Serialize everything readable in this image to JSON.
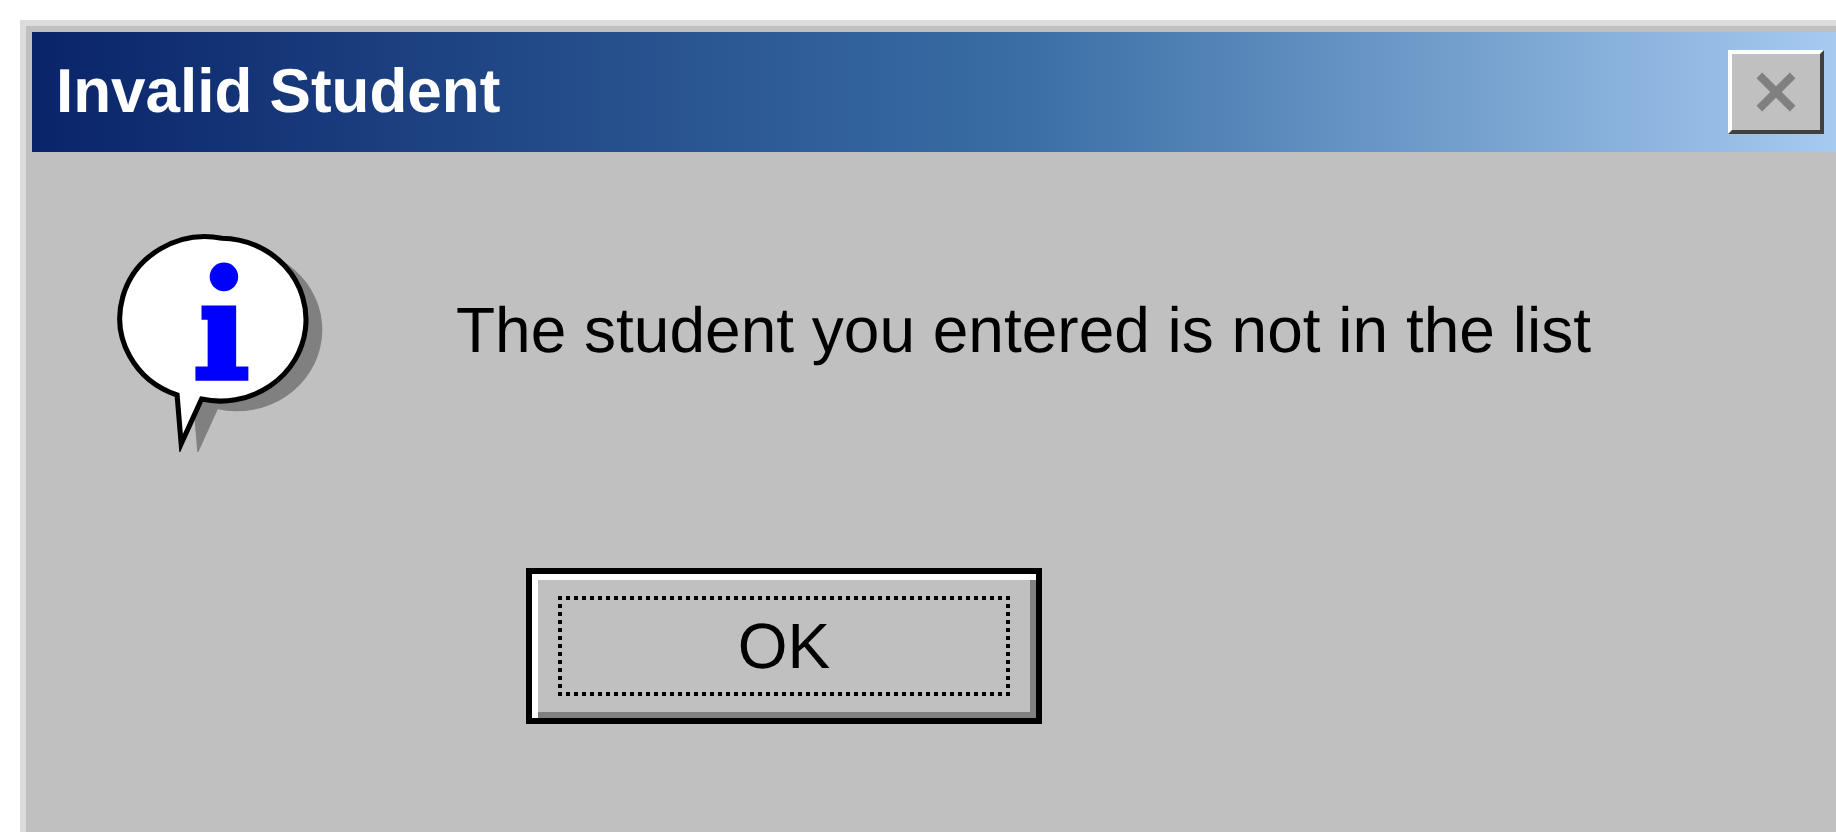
{
  "window": {
    "title": "Invalid Student",
    "close_button": {
      "disabled": true
    }
  },
  "message": "The student you entered is not in the list",
  "buttons": [
    {
      "label": "OK",
      "focused": true
    }
  ]
}
